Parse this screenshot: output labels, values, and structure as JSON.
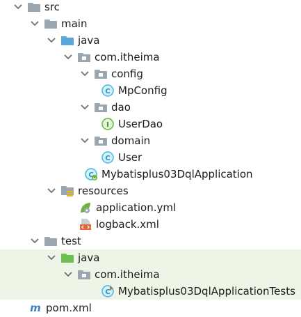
{
  "colors": {
    "folder_gray": "#9aa7b0",
    "folder_blue": "#5aa7db",
    "folder_green": "#6cbf4f",
    "package_gray": "#9aa7b0",
    "class_circle": "#40b6e0",
    "interface_circle": "#62b543",
    "test_background": "#eef5e6",
    "maven_m": "#3f7ec7",
    "xml_orange": "#e26b3d",
    "spring_green": "#6db33f"
  },
  "tree": {
    "src": {
      "label": "src",
      "icon": "folder-gray-icon"
    },
    "main": {
      "label": "main",
      "icon": "folder-gray-icon"
    },
    "java_main": {
      "label": "java",
      "icon": "folder-blue-source-icon"
    },
    "com_itheima_main": {
      "label": "com.itheima",
      "icon": "package-icon"
    },
    "config": {
      "label": "config",
      "icon": "package-icon"
    },
    "mpconfig": {
      "label": "MpConfig",
      "icon": "class-icon",
      "glyph": "C"
    },
    "dao": {
      "label": "dao",
      "icon": "package-icon"
    },
    "userdao": {
      "label": "UserDao",
      "icon": "interface-icon",
      "glyph": "I"
    },
    "domain": {
      "label": "domain",
      "icon": "package-icon"
    },
    "user": {
      "label": "User",
      "icon": "class-icon",
      "glyph": "C"
    },
    "app": {
      "label": "Mybatisplus03DqlApplication",
      "icon": "spring-boot-class-icon",
      "glyph": "C"
    },
    "resources": {
      "label": "resources",
      "icon": "resources-folder-icon"
    },
    "application_yml": {
      "label": "application.yml",
      "icon": "spring-config-icon"
    },
    "logback_xml": {
      "label": "logback.xml",
      "icon": "xml-file-icon"
    },
    "test": {
      "label": "test",
      "icon": "folder-gray-icon"
    },
    "java_test": {
      "label": "java",
      "icon": "folder-green-test-icon"
    },
    "com_itheima_test": {
      "label": "com.itheima",
      "icon": "package-icon"
    },
    "app_tests": {
      "label": "Mybatisplus03DqlApplicationTests",
      "icon": "test-class-icon",
      "glyph": "C"
    },
    "pom": {
      "label": "pom.xml",
      "icon": "maven-icon",
      "glyph": "m"
    }
  }
}
